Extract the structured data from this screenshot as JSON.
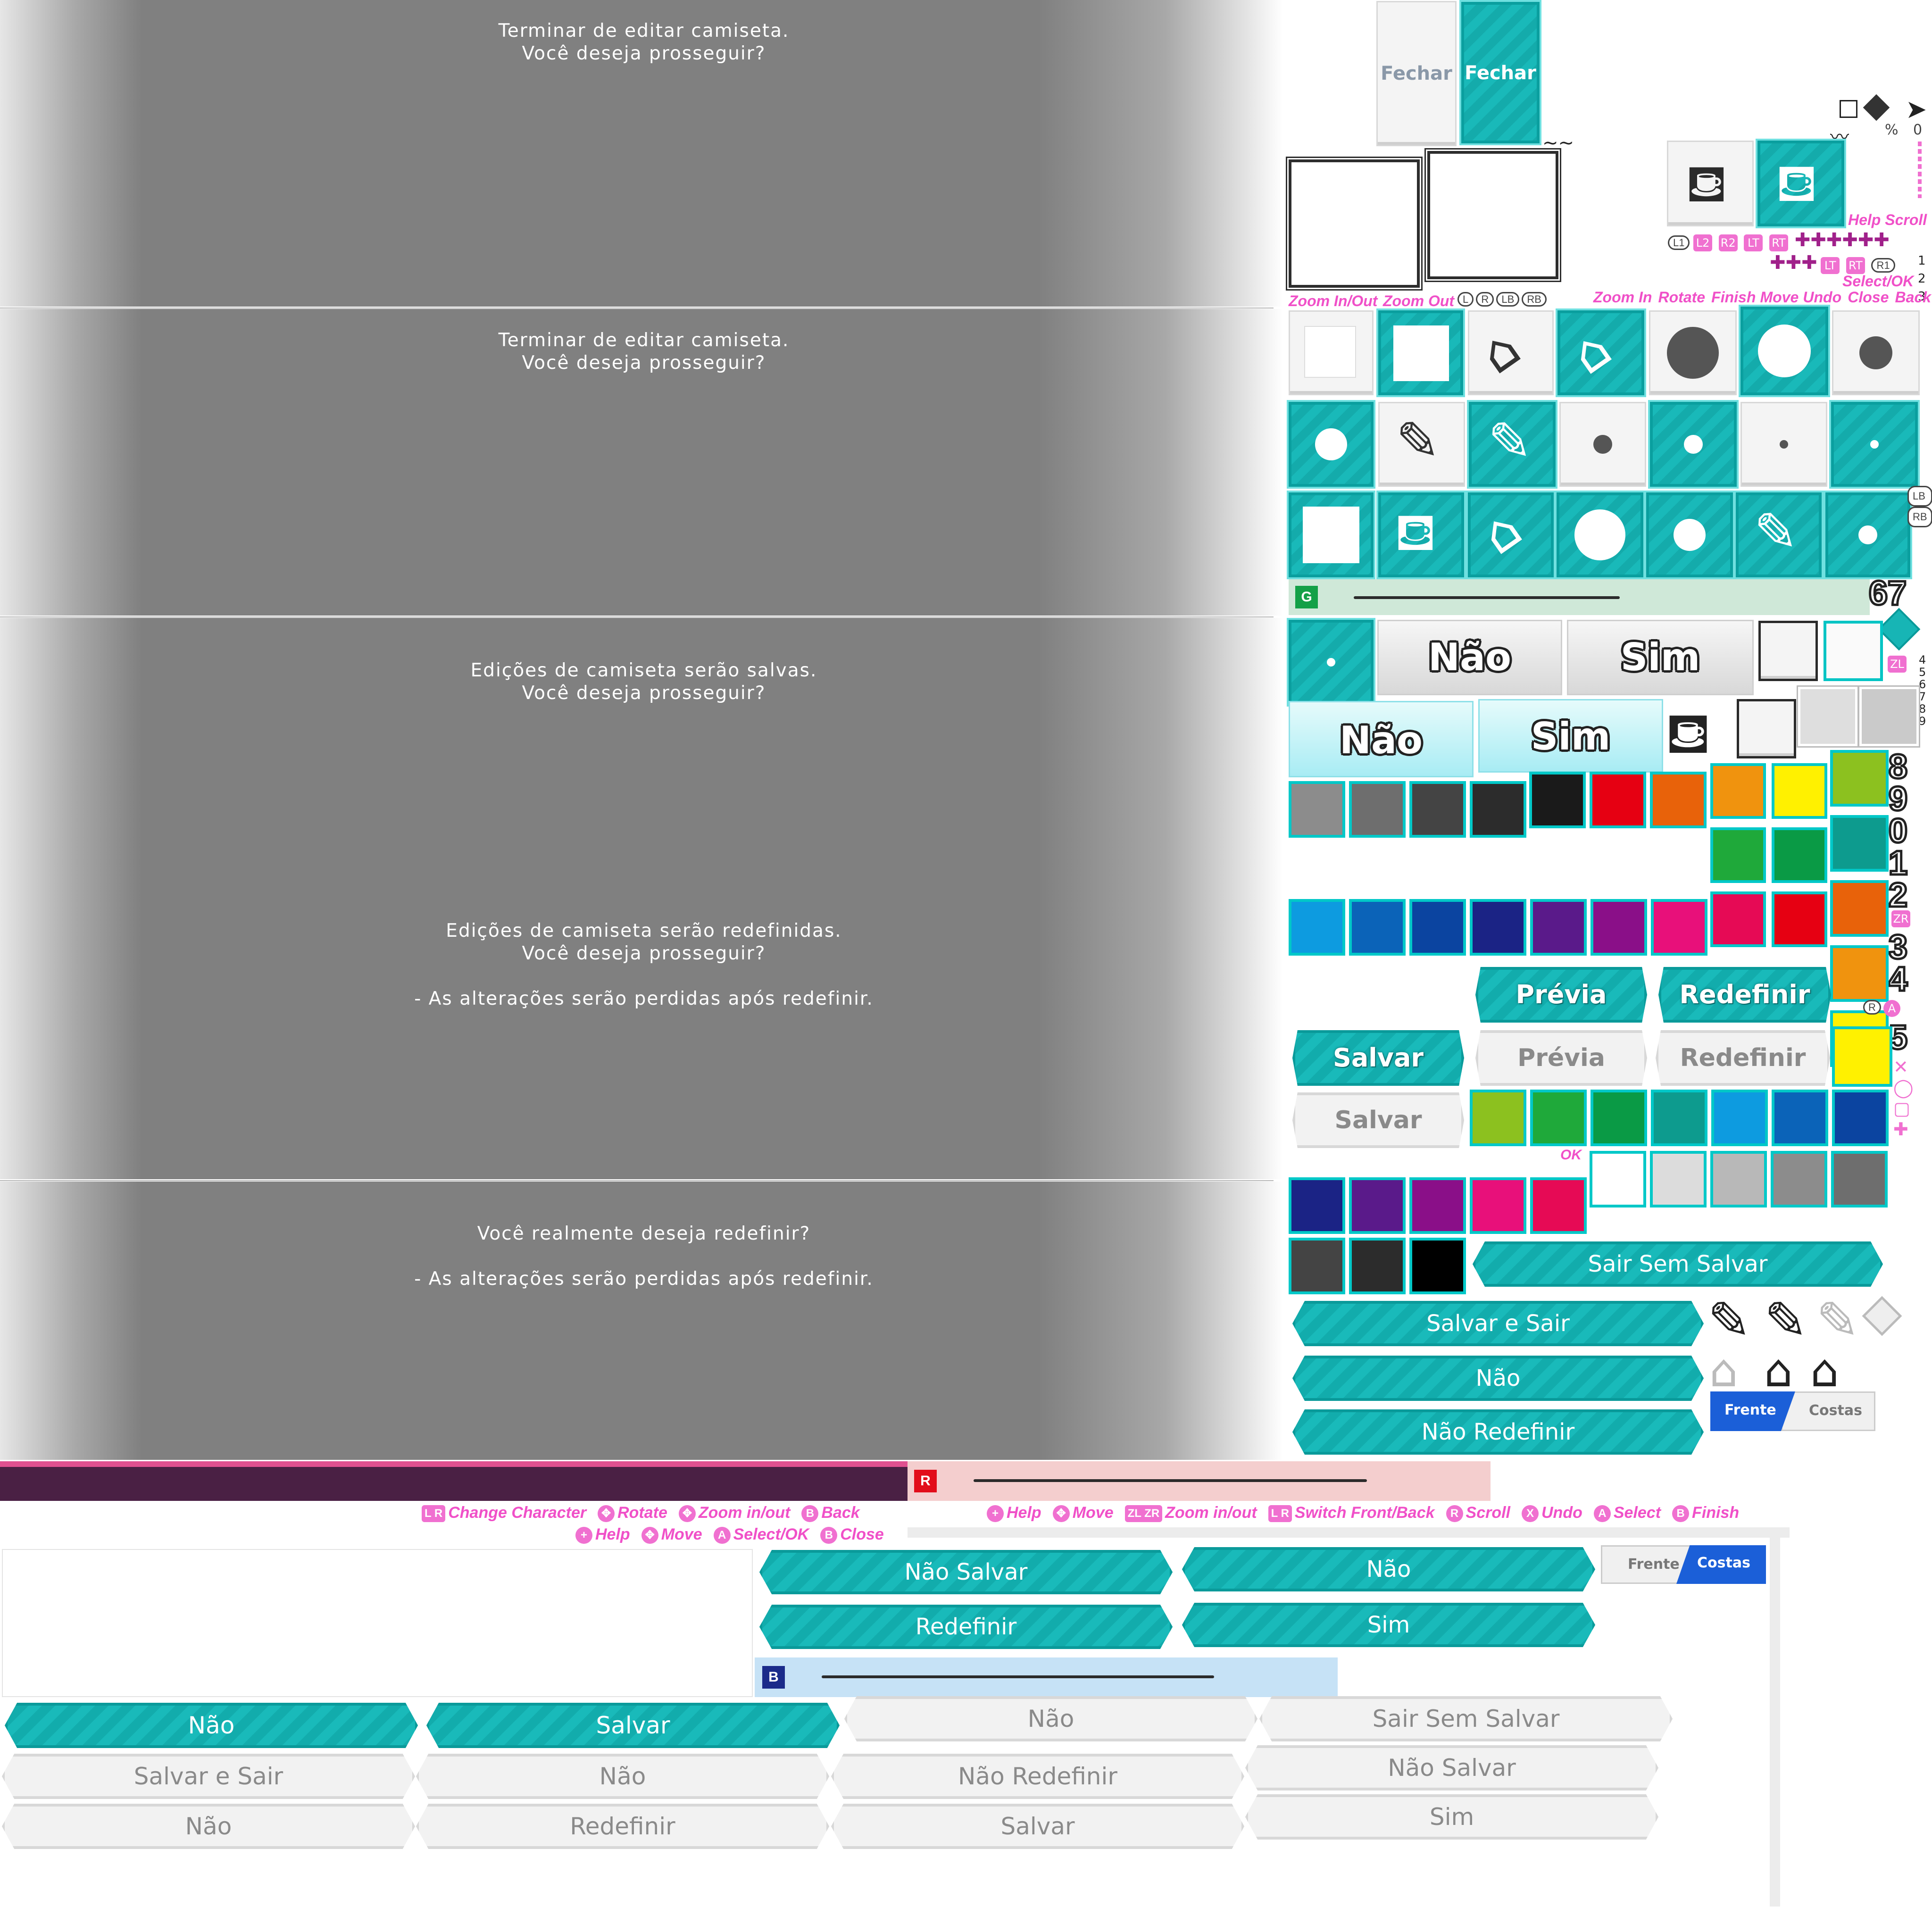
{
  "dialogs": [
    {
      "line1": "Terminar de editar camiseta.",
      "line2": "Você deseja prosseguir?",
      "line3": "",
      "line4": ""
    },
    {
      "line1": "Terminar de editar camiseta.",
      "line2": "Você deseja prosseguir?",
      "line3": "",
      "line4": ""
    },
    {
      "line1": "Edições de camiseta serão salvas.",
      "line2": "Você deseja prosseguir?",
      "line3": "",
      "line4": ""
    },
    {
      "line1": "Edições de camiseta serão redefinidas.",
      "line2": "Você deseja prosseguir?",
      "line3": "",
      "line4": "- As alterações serão perdidas após redefinir."
    },
    {
      "line1": "Você realmente deseja redefinir?",
      "line2": "",
      "line3": "- As alterações serão perdidas após redefinir.",
      "line4": ""
    }
  ],
  "close_buttons": {
    "normal": "Fechar",
    "selected": "Fechar"
  },
  "hints_top": {
    "help_scroll": "Help Scroll",
    "select_ok": "Select/OK",
    "zoom_inout": "Zoom In/Out",
    "zoom_out": "Zoom Out",
    "zoom_in": "Zoom In",
    "rotate": "Rotate",
    "finish": "Finish",
    "move": "Move",
    "undo": "Undo",
    "close": "Close",
    "back": "Back",
    "ok": "OK",
    "percent": "%",
    "zero": "0"
  },
  "button_tags": {
    "l1": "L1",
    "l2": "L2",
    "r2": "R2",
    "lt": "LT",
    "rt": "RT",
    "r1": "R1",
    "l": "L",
    "r": "R",
    "lb": "LB",
    "rb": "RB",
    "zl": "ZL",
    "zr": "ZR",
    "a": "A",
    "b": "B",
    "x": "X"
  },
  "side_numbers": {
    "n1": "1",
    "n2": "2",
    "n3": "3",
    "n4": "4",
    "n5": "5",
    "n6": "6",
    "n7": "7",
    "n8": "8",
    "n9": "9"
  },
  "big_numbers": {
    "six_seven": "67",
    "eight": "8",
    "nine": "9",
    "zero": "0",
    "one": "1",
    "two": "2",
    "three": "3",
    "four": "4",
    "five": "5"
  },
  "choice_buttons": {
    "no": "Não",
    "yes": "Sim"
  },
  "action_buttons": {
    "preview": "Prévia",
    "reset": "Redefinir",
    "save": "Salvar"
  },
  "wide_buttons": {
    "exit_no_save": "Sair Sem Salvar",
    "save_and_exit": "Salvar e Sair",
    "no": "Não",
    "no_reset": "Não Redefinir"
  },
  "side_toggle": {
    "front": "Frente",
    "back": "Costas"
  },
  "bars": {
    "g": "G",
    "r": "R",
    "b": "B"
  },
  "hint_row_1": [
    {
      "btn": "L R",
      "label": "Change Character"
    },
    {
      "btn": "✥",
      "label": "Rotate"
    },
    {
      "btn": "✥",
      "label": "Zoom in/out"
    },
    {
      "btn": "B",
      "label": "Back"
    }
  ],
  "hint_row_2": [
    {
      "btn": "+",
      "label": "Help"
    },
    {
      "btn": "✥",
      "label": "Move"
    },
    {
      "btn": "A",
      "label": "Select/OK"
    },
    {
      "btn": "B",
      "label": "Close"
    }
  ],
  "hint_row_3": [
    {
      "btn": "+",
      "label": "Help"
    },
    {
      "btn": "✥",
      "label": "Move"
    },
    {
      "btn": "ZL ZR",
      "label": "Zoom in/out"
    },
    {
      "btn": "L R",
      "label": "Switch Front/Back"
    },
    {
      "btn": "R",
      "label": "Scroll"
    },
    {
      "btn": "X",
      "label": "Undo"
    },
    {
      "btn": "A",
      "label": "Select"
    },
    {
      "btn": "B",
      "label": "Finish"
    }
  ],
  "bottom_cyan_buttons": {
    "no_save": "Não Salvar",
    "no": "Não",
    "reset": "Redefinir",
    "yes": "Sim"
  },
  "bottom_rows": {
    "r1c1": "Não",
    "r1c2": "Salvar",
    "r1c3": "Não",
    "r1c4": "Sair Sem Salvar",
    "r2c1": "Salvar e Sair",
    "r2c2": "Não",
    "r2c3": "Não Redefinir",
    "r2c4": "Não Salvar",
    "r3c1": "Não",
    "r3c2": "Redefinir",
    "r3c3": "Salvar",
    "r3c4": "Sim"
  },
  "colors": {
    "accent": "#17b5b5",
    "hint": "#f050c8",
    "palette_row1": [
      "#1a1a1a",
      "#e60012",
      "#e8620a"
    ],
    "palette_greys": [
      "#8c8c8c",
      "#6e6e6e",
      "#444444",
      "#2c2c2c"
    ],
    "palette_blues": [
      "#0d9be0",
      "#0b63b8",
      "#0b44a0",
      "#1b2385",
      "#5a1a8a",
      "#8a0f88",
      "#e8107a"
    ],
    "palette_col_a": [
      "#f0930e",
      "#1fa93a",
      "#e60a55"
    ],
    "palette_col_b": [
      "#fff100",
      "#0a9a45",
      "#e60012"
    ],
    "palette_col_c": [
      "#8cc11f",
      "#0d9b8e",
      "#e8620a",
      "#f0930e",
      "#fff100"
    ],
    "palette_row_greens": [
      "#8cc11f",
      "#1fa93a",
      "#0a9a45",
      "#0d9b8e",
      "#0d9be0",
      "#0b63b8",
      "#0b44a0"
    ],
    "palette_row_greys": [
      "#ffffff",
      "#dcdcdc",
      "#b8b8b8",
      "#8c8c8c",
      "#6e6e6e"
    ],
    "palette_row_purples": [
      "#1b2385",
      "#5a1a8a",
      "#8a0f88",
      "#e8107a",
      "#e60a55"
    ],
    "palette_row_darks": [
      "#444444",
      "#2c2c2c",
      "#000000"
    ]
  }
}
